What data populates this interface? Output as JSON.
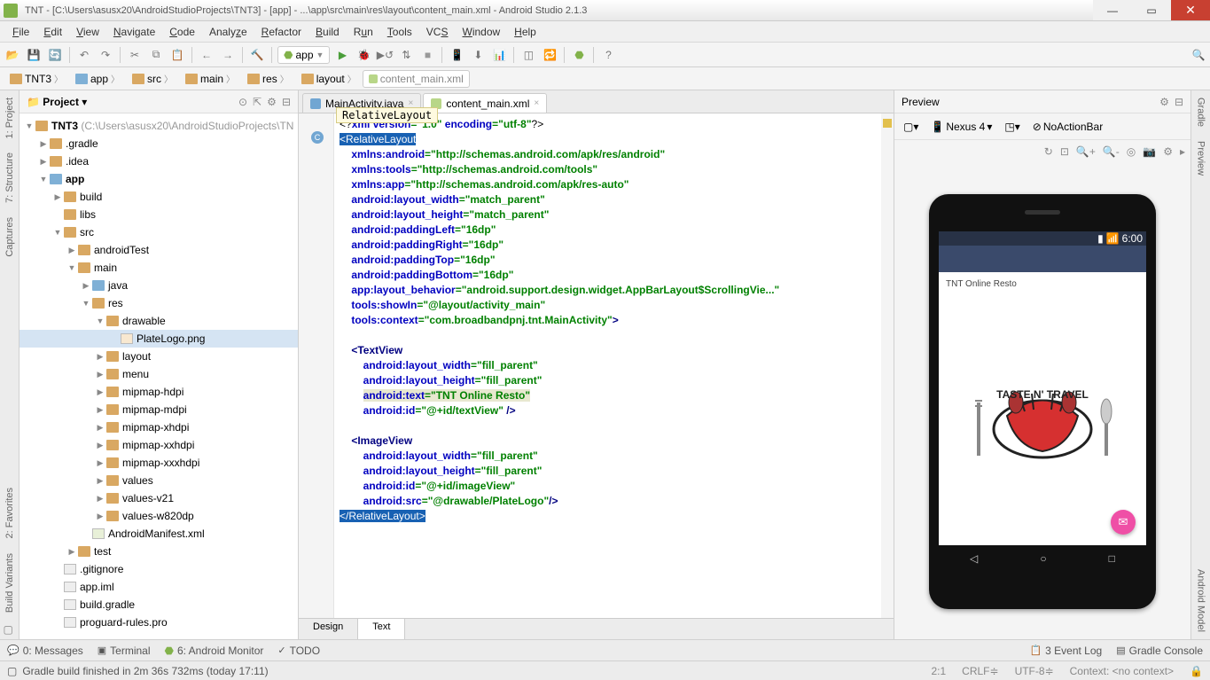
{
  "title": "TNT - [C:\\Users\\asusx20\\AndroidStudioProjects\\TNT3] - [app] - ...\\app\\src\\main\\res\\layout\\content_main.xml - Android Studio 2.1.3",
  "menu": [
    "File",
    "Edit",
    "View",
    "Navigate",
    "Code",
    "Analyze",
    "Refactor",
    "Build",
    "Run",
    "Tools",
    "VCS",
    "Window",
    "Help"
  ],
  "runConfig": "app",
  "breadcrumbs": [
    "TNT3",
    "app",
    "src",
    "main",
    "res",
    "layout",
    "content_main.xml"
  ],
  "projectPanel": {
    "title": "Project"
  },
  "tree": {
    "root": "TNT3",
    "rootPath": "(C:\\Users\\asusx20\\AndroidStudioProjects\\TN",
    "gradleDir": ".gradle",
    "ideaDir": ".idea",
    "app": "app",
    "build": "build",
    "libs": "libs",
    "src": "src",
    "androidTest": "androidTest",
    "main": "main",
    "java": "java",
    "res": "res",
    "drawable": "drawable",
    "plateLogo": "PlateLogo.png",
    "layout": "layout",
    "menu": "menu",
    "mipmapHdpi": "mipmap-hdpi",
    "mipmapMdpi": "mipmap-mdpi",
    "mipmapXhdpi": "mipmap-xhdpi",
    "mipmapXxhdpi": "mipmap-xxhdpi",
    "mipmapXxxhdpi": "mipmap-xxxhdpi",
    "values": "values",
    "valuesV21": "values-v21",
    "valuesW820": "values-w820dp",
    "manifest": "AndroidManifest.xml",
    "test": "test",
    "gitignore": ".gitignore",
    "appIml": "app.iml",
    "buildGradle": "build.gradle",
    "proguard": "proguard-rules.pro"
  },
  "tabs": [
    {
      "label": "MainActivity.java",
      "active": false
    },
    {
      "label": "content_main.xml",
      "active": true
    }
  ],
  "breadcrumbHint": "RelativeLayout",
  "code": {
    "l1a": "<?",
    "l1b": "xml version",
    "l1c": "=\"1.0\" ",
    "l1d": "encoding",
    "l1e": "=\"utf-8\"",
    "l1f": "?>",
    "l2": "<RelativeLayout",
    "l3a": "xmlns:android",
    "l3b": "=\"http://schemas.android.com/apk/res/android\"",
    "l4a": "xmlns:tools",
    "l4b": "=\"http://schemas.android.com/tools\"",
    "l5a": "xmlns:app",
    "l5b": "=\"http://schemas.android.com/apk/res-auto\"",
    "l6a": "android:layout_width",
    "l6b": "=\"match_parent\"",
    "l7a": "android:layout_height",
    "l7b": "=\"match_parent\"",
    "l8a": "android:paddingLeft",
    "l8b": "=\"16dp\"",
    "l9a": "android:paddingRight",
    "l9b": "=\"16dp\"",
    "l10a": "android:paddingTop",
    "l10b": "=\"16dp\"",
    "l11a": "android:paddingBottom",
    "l11b": "=\"16dp\"",
    "l12a": "app:layout_behavior",
    "l12b": "=\"android.support.design.widget.AppBarLayout$ScrollingVie...\"",
    "l13a": "tools:showIn",
    "l13b": "=\"@layout/activity_main\"",
    "l14a": "tools:context",
    "l14b": "=\"com.broadbandpnj.tnt.MainActivity\"",
    "l14c": ">",
    "l16": "<TextView",
    "l17a": "android:layout_width",
    "l17b": "=\"fill_parent\"",
    "l18a": "android:layout_height",
    "l18b": "=\"fill_parent\"",
    "l19a": "android:text",
    "l19b": "=\"TNT Online Resto\"",
    "l20a": "android:id",
    "l20b": "=\"@+id/textView\"",
    "l20c": " />",
    "l22": "<ImageView",
    "l23a": "android:layout_width",
    "l23b": "=\"fill_parent\"",
    "l24a": "android:layout_height",
    "l24b": "=\"fill_parent\"",
    "l25a": "android:id",
    "l25b": "=\"@+id/imageView\"",
    "l26a": "android:src",
    "l26b": "=\"@drawable/PlateLogo\"",
    "l26c": "/>",
    "l27": "</RelativeLayout>"
  },
  "designTabs": [
    "Design",
    "Text"
  ],
  "preview": {
    "title": "Preview",
    "device": "Nexus 4",
    "theme": "NoActionBar",
    "time": "6:00",
    "appText": "TNT Online Resto",
    "logoText": "TASTE N' TRAVEL"
  },
  "bottom": {
    "messages": "0: Messages",
    "terminal": "Terminal",
    "monitor": "6: Android Monitor",
    "todo": "TODO",
    "eventLog": "3  Event Log",
    "gradleConsole": "Gradle Console"
  },
  "status": {
    "msg": "Gradle build finished in 2m 36s 732ms (today 17:11)",
    "pos": "2:1",
    "crlf": "CRLF",
    "enc": "UTF-8",
    "ctx": "Context: <no context>"
  },
  "leftLabels": {
    "project": "1: Project",
    "structure": "7: Structure",
    "captures": "Captures",
    "favorites": "2: Favorites",
    "variants": "Build Variants"
  },
  "rightLabels": {
    "gradle": "Gradle",
    "preview": "Preview",
    "model": "Android Model"
  }
}
